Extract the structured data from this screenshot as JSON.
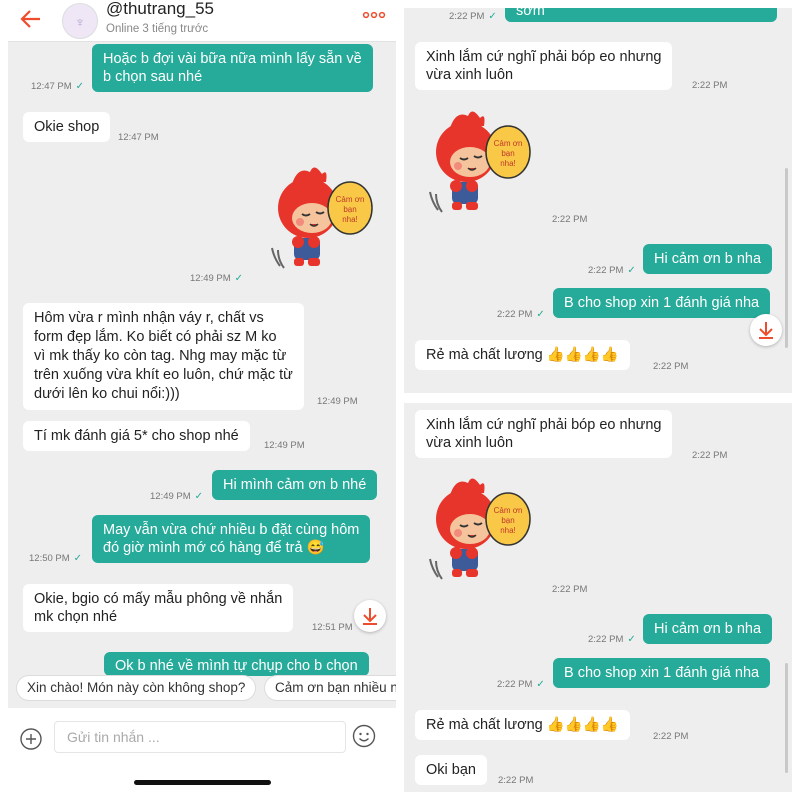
{
  "header": {
    "username": "@thutrang_55",
    "status": "Online 3 tiếng trước"
  },
  "left_messages": [
    {
      "text": "Hoặc b đợi vài bữa nữa mình lấy sẵn về\nb chọn sau nhé",
      "time": "12:47 PM"
    },
    {
      "text": "Okie shop",
      "time": "12:47 PM"
    },
    {
      "time": "12:49 PM"
    },
    {
      "text": "Hôm vừa r mình nhận váy r, chất vs\nform đẹp lắm. Ko biết có phải sz M ko\nvì mk thấy ko còn tag. Nhg may mặc từ\ntrên xuống vừa khít eo luôn, chứ mặc từ\ndưới lên ko chui nổi:)))",
      "time": "12:49 PM"
    },
    {
      "text": "Tí mk đánh giá 5* cho shop nhé",
      "time": "12:49 PM"
    },
    {
      "text": "Hi mình cảm ơn b nhé",
      "time": "12:49 PM"
    },
    {
      "text": "May vẫn vừa chứ nhiều b đặt cùng hôm\nđó giờ mình mớ có hàng để trả 😅",
      "time": "12:50 PM"
    },
    {
      "text": "Okie, bgio có mấy mẫu phông về nhắn\nmk chọn nhé",
      "time": "12:51 PM"
    },
    {
      "text": "Ok b nhé về mình tự chụp cho b chọn"
    }
  ],
  "quick_replies": [
    "Xin chào! Món này còn không shop?",
    "Cảm ơn bạn nhiều nhé"
  ],
  "input": {
    "placeholder": "Gửi tin nhắn ..."
  },
  "sticker": {
    "text": "Cảm ơn bạn nha!"
  },
  "top_messages": [
    {
      "time": "2:22 PM",
      "text": "sớm"
    },
    {
      "text": "Xinh lắm cứ nghĩ phải bóp eo nhưng\nvừa xinh luôn",
      "time": "2:22 PM"
    },
    {
      "time": "2:22 PM"
    },
    {
      "text": "Hi cảm ơn b nha",
      "time": "2:22 PM"
    },
    {
      "text": "B cho shop xin 1 đánh giá nha",
      "time": "2:22 PM"
    },
    {
      "text": "Rẻ mà chất lương 👍👍👍👍",
      "time": "2:22 PM"
    }
  ],
  "bottom_messages": [
    {
      "text": "Xinh lắm cứ nghĩ phải bóp eo nhưng\nvừa xinh luôn",
      "time": "2:22 PM"
    },
    {
      "time": "2:22 PM"
    },
    {
      "text": "Hi cảm ơn b nha",
      "time": "2:22 PM"
    },
    {
      "text": "B cho shop xin 1 đánh giá nha",
      "time": "2:22 PM"
    },
    {
      "text": "Rẻ mà chất lương 👍👍👍👍",
      "time": "2:22 PM"
    },
    {
      "text": "Oki bạn",
      "time": "2:22 PM"
    }
  ],
  "colors": {
    "accent": "#26aa99",
    "header_icon": "#ee4d2d",
    "background": "#eeeeee"
  }
}
